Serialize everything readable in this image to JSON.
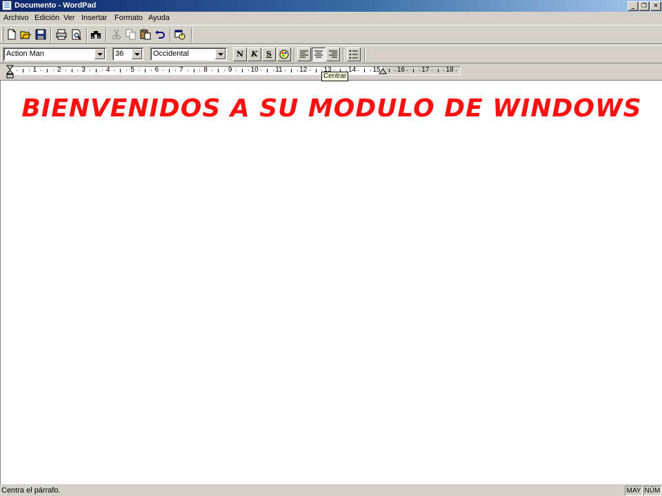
{
  "window": {
    "title": "Documento - WordPad",
    "controls": {
      "minimize": "_",
      "restore": "❐",
      "close": "✕"
    }
  },
  "menu": [
    "Archivo",
    "Edición",
    "Ver",
    "Insertar",
    "Formato",
    "Ayuda"
  ],
  "toolbar": {
    "buttons": [
      "new-icon",
      "open-icon",
      "save-icon",
      "print-icon",
      "print-preview-icon",
      "find-icon",
      "cut-icon",
      "copy-icon",
      "paste-icon",
      "undo-icon",
      "date-time-icon"
    ]
  },
  "format_bar": {
    "font": "Action Man",
    "size": "36",
    "script": "Occidental",
    "bold": "N",
    "italic": "K",
    "underline": "S",
    "color_icon": "color-icon",
    "align": [
      "align-left-icon",
      "align-center-icon",
      "align-right-icon"
    ],
    "active_align": "center",
    "bullets_icon": "bullets-icon"
  },
  "ruler": {
    "numbers": [
      "1",
      "2",
      "3",
      "4",
      "5",
      "6",
      "7",
      "8",
      "9",
      "10",
      "11",
      "12",
      "13",
      "14",
      "15",
      "16",
      "17",
      "18"
    ]
  },
  "tooltip": "Centrar",
  "document": {
    "text": "BIENVENIDOS A SU MODULO DE WINDOWS",
    "text_color": "#ff1010"
  },
  "status": {
    "message": "Centra el párrafo.",
    "caps": "MAY",
    "num": "NÚM"
  },
  "colors": {
    "title_active": "#0a246a",
    "face": "#d4d0c8",
    "tooltip_bg": "#ffffe1"
  }
}
